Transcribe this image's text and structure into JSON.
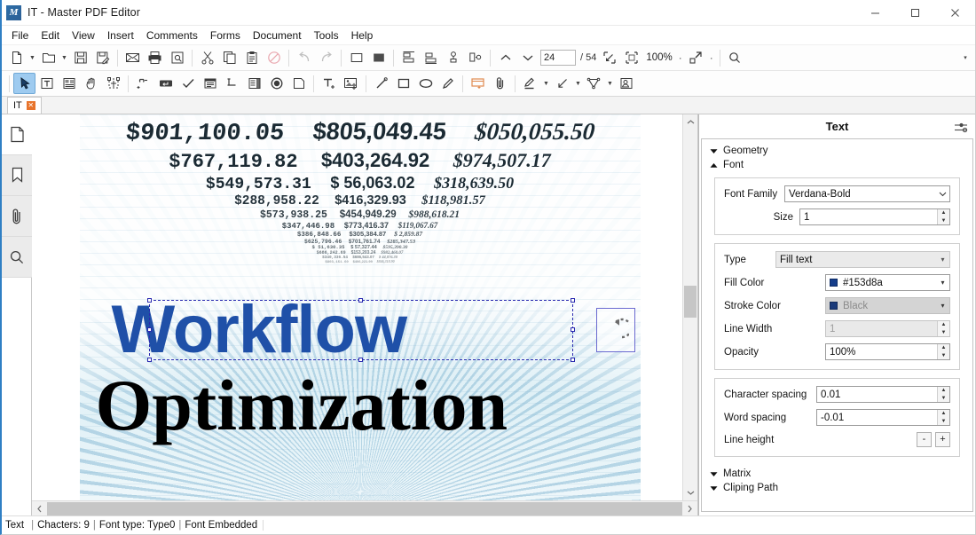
{
  "window": {
    "title": "IT - Master PDF Editor",
    "logo_text": "M",
    "minimize_label": "–",
    "maximize_label": "☐",
    "close_label": "✕"
  },
  "menubar": {
    "items": [
      {
        "label": "File"
      },
      {
        "label": "Edit"
      },
      {
        "label": "View"
      },
      {
        "label": "Insert"
      },
      {
        "label": "Comments"
      },
      {
        "label": "Forms"
      },
      {
        "label": "Document"
      },
      {
        "label": "Tools"
      },
      {
        "label": "Help"
      }
    ]
  },
  "toolbar_main": {
    "page_current": "24",
    "page_total": "/ 54",
    "zoom_level": "100%",
    "dot_label": "·",
    "overflow_label": "▾",
    "buttons": [
      {
        "name": "new-document-button",
        "icon": "new-document-icon",
        "tip": "New"
      },
      {
        "name": "open-document-button",
        "icon": "open-folder-icon",
        "tip": "Open"
      },
      {
        "name": "save-button",
        "icon": "save-disk-icon",
        "tip": "Save"
      },
      {
        "name": "save-as-button",
        "icon": "save-as-icon",
        "tip": "Save As"
      },
      {
        "name": "email-button",
        "icon": "envelope-icon",
        "tip": "Send by Email"
      },
      {
        "name": "print-button",
        "icon": "printer-icon",
        "tip": "Print"
      },
      {
        "name": "print-preview-button",
        "icon": "print-preview-icon",
        "tip": "Print Preview"
      },
      {
        "name": "cut-button",
        "icon": "scissors-icon",
        "tip": "Cut"
      },
      {
        "name": "copy-button",
        "icon": "copy-icon",
        "tip": "Copy"
      },
      {
        "name": "paste-button",
        "icon": "clipboard-icon",
        "tip": "Paste"
      },
      {
        "name": "delete-button",
        "icon": "no-entry-icon",
        "tip": "Delete"
      },
      {
        "name": "undo-button",
        "icon": "undo-arrow-icon",
        "tip": "Undo"
      },
      {
        "name": "redo-button",
        "icon": "redo-arrow-icon",
        "tip": "Redo"
      },
      {
        "name": "fill-none-button",
        "icon": "square-outline-icon",
        "tip": "No Fill"
      },
      {
        "name": "fill-solid-button",
        "icon": "square-filled-icon",
        "tip": "Fill"
      },
      {
        "name": "align-top-button",
        "icon": "align-top-icon",
        "tip": "Align Top"
      },
      {
        "name": "align-bottom-button",
        "icon": "align-bottom-icon",
        "tip": "Align Bottom"
      },
      {
        "name": "align-left-button",
        "icon": "align-left-icon",
        "tip": "Align Left"
      },
      {
        "name": "align-right-button",
        "icon": "align-right-icon",
        "tip": "Align Right"
      },
      {
        "name": "align-center-h-button",
        "icon": "align-center-h-icon",
        "tip": "Center Horizontally"
      },
      {
        "name": "distribute-button",
        "icon": "distribute-icon",
        "tip": "Distribute"
      },
      {
        "name": "previous-page-button",
        "icon": "chevron-up-icon",
        "tip": "Previous Page"
      },
      {
        "name": "next-page-button",
        "icon": "chevron-down-icon",
        "tip": "Next Page"
      },
      {
        "name": "fit-page-button",
        "icon": "fit-page-icon",
        "tip": "Fit Page"
      },
      {
        "name": "fit-width-button",
        "icon": "fit-width-icon",
        "tip": "Fit Width"
      },
      {
        "name": "fullscreen-button",
        "icon": "fullscreen-icon",
        "tip": "Full Screen"
      },
      {
        "name": "find-button",
        "icon": "search-icon",
        "tip": "Find"
      }
    ]
  },
  "toolbar_tools": {
    "buttons": [
      {
        "name": "select-tool-button",
        "icon": "cursor-arrow-icon",
        "active": true
      },
      {
        "name": "edit-text-tool-button",
        "icon": "edit-text-icon"
      },
      {
        "name": "edit-object-tool-button",
        "icon": "edit-object-icon"
      },
      {
        "name": "hand-tool-button",
        "icon": "hand-icon"
      },
      {
        "name": "crop-tool-button",
        "icon": "crop-icon"
      },
      {
        "name": "add-link-button",
        "icon": "link-icon"
      },
      {
        "name": "text-field-button",
        "icon": "text-field-icon"
      },
      {
        "name": "checkbox-field-button",
        "icon": "checkmark-icon"
      },
      {
        "name": "combobox-field-button",
        "icon": "combobox-icon"
      },
      {
        "name": "listbox-field-button",
        "icon": "listbox-icon"
      },
      {
        "name": "form-field-button",
        "icon": "form-list-icon"
      },
      {
        "name": "radio-button-field",
        "icon": "radio-button-icon"
      },
      {
        "name": "button-field-button",
        "icon": "push-button-icon"
      },
      {
        "name": "add-text-button",
        "icon": "add-text-icon"
      },
      {
        "name": "add-image-button",
        "icon": "add-image-icon"
      },
      {
        "name": "line-tool-button",
        "icon": "line-icon"
      },
      {
        "name": "rectangle-tool-button",
        "icon": "rectangle-icon"
      },
      {
        "name": "ellipse-tool-button",
        "icon": "ellipse-icon"
      },
      {
        "name": "pencil-tool-button",
        "icon": "pencil-icon"
      },
      {
        "name": "sticky-note-button",
        "icon": "sticky-note-icon"
      },
      {
        "name": "attachment-button",
        "icon": "paperclip-icon"
      },
      {
        "name": "highlight-button",
        "icon": "highlighter-icon"
      },
      {
        "name": "arrow-annotation-button",
        "icon": "arrow-annotation-icon"
      },
      {
        "name": "polygon-tool-button",
        "icon": "polygon-icon"
      },
      {
        "name": "stamp-tool-button",
        "icon": "stamp-icon"
      }
    ]
  },
  "tabstrip": {
    "tabs": [
      {
        "label": "IT",
        "close_label": "✕"
      }
    ]
  },
  "sidebar": {
    "items": [
      {
        "name": "sidebar-item-pages",
        "icon": "page-thumbnail-icon",
        "label": "Pages"
      },
      {
        "name": "sidebar-item-bookmarks",
        "icon": "bookmark-icon",
        "label": "Bookmarks"
      },
      {
        "name": "sidebar-item-attachments",
        "icon": "paperclip-icon",
        "label": "Attachments"
      },
      {
        "name": "sidebar-item-search",
        "icon": "search-icon",
        "label": "Search"
      }
    ]
  },
  "document": {
    "headline_selected": "Workflow",
    "headline_second": "Optimization",
    "background_rows": [
      {
        "c1": "$901,100.05",
        "c2": "$805,049.45",
        "c3": "$050,055.50",
        "size": 27,
        "opacity": 1
      },
      {
        "c1": "$767,119.82",
        "c2": "$403,264.92",
        "c3": "$974,507.17",
        "size": 22,
        "opacity": 1
      },
      {
        "c1": "$549,573.31",
        "c2": "$ 56,063.02",
        "c3": "$318,639.50",
        "size": 18,
        "opacity": 1
      },
      {
        "c1": "$288,958.22",
        "c2": "$416,329.93",
        "c3": "$118,981.57",
        "size": 14.5,
        "opacity": 0.95
      },
      {
        "c1": "$573,938.25",
        "c2": "$454,949.29",
        "c3": "$988,618.21",
        "size": 11.5,
        "opacity": 0.9
      },
      {
        "c1": "$347,446.98",
        "c2": "$773,416.37",
        "c3": "$119,067.67",
        "size": 9,
        "opacity": 0.85
      },
      {
        "c1": "$386,848.66",
        "c2": "$305,384.87",
        "c3": "$  2,859.87",
        "size": 7.5,
        "opacity": 0.8
      },
      {
        "c1": "$625,796.46",
        "c2": "$701,761.74",
        "c3": "$285,347.53",
        "size": 6.4,
        "opacity": 0.75
      },
      {
        "c1": "$ 51,630.35",
        "c2": "$ 57,327.44",
        "c3": "$595,390.30",
        "size": 5.6,
        "opacity": 0.7
      },
      {
        "c1": "$686,242.69",
        "c2": "$153,203.24",
        "c3": "$982,460.07",
        "size": 5,
        "opacity": 0.62
      },
      {
        "c1": "$340,336.54",
        "c2": "$686,543.07",
        "c3": "$ 44,876.30",
        "size": 4.4,
        "opacity": 0.55
      },
      {
        "c1": "$803,151.60",
        "c2": "$406,221.99",
        "c3": "$846,318.90",
        "size": 4,
        "opacity": 0.45
      }
    ]
  },
  "properties_panel": {
    "title": "Text",
    "settings_icon": "sliders-icon",
    "sections": [
      {
        "name": "geometry-section",
        "label": "Geometry",
        "expanded": false
      },
      {
        "name": "font-section",
        "label": "Font",
        "expanded": true
      },
      {
        "name": "matrix-section",
        "label": "Matrix",
        "expanded": false
      },
      {
        "name": "clipping-path-section",
        "label": "Cliping Path",
        "expanded": false
      }
    ],
    "font": {
      "family_label": "Font Family",
      "family_value": "Verdana-Bold",
      "size_label": "Size",
      "size_value": "1"
    },
    "paint": {
      "type_label": "Type",
      "type_value": "Fill text",
      "fill_color_label": "Fill Color",
      "fill_color_value": "#153d8a",
      "fill_color_hex": "#153d8a",
      "stroke_color_label": "Stroke Color",
      "stroke_color_value": "Black",
      "stroke_color_hex": "#1a3a7a",
      "line_width_label": "Line Width",
      "line_width_value": "1",
      "opacity_label": "Opacity",
      "opacity_value": "100%"
    },
    "spacing": {
      "character_spacing_label": "Character spacing",
      "character_spacing_value": "0.01",
      "word_spacing_label": "Word spacing",
      "word_spacing_value": "-0.01",
      "line_height_label": "Line height",
      "line_height_minus": "-",
      "line_height_plus": "+"
    }
  },
  "statusbar": {
    "type": "Text",
    "characters": "Chacters: 9",
    "font_type": "Font type: Type0",
    "embedded": "Font Embedded",
    "separator": "|"
  }
}
